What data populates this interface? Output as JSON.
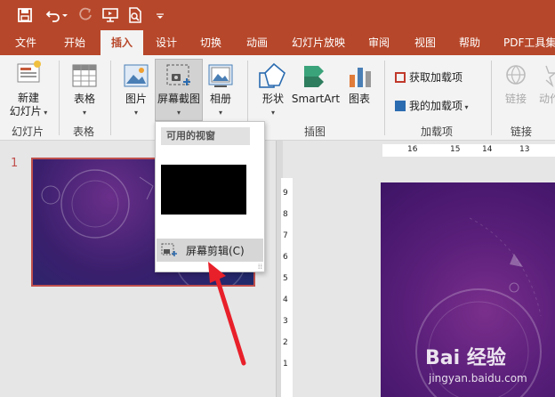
{
  "quick_access": {
    "save_icon": "save-icon",
    "undo_icon": "undo-icon",
    "redo_icon": "redo-icon",
    "present_icon": "present-from-beginning-icon",
    "print_preview_icon": "print-preview-icon",
    "customize_icon": "customize-qat-icon"
  },
  "tabs": [
    {
      "label": "文件"
    },
    {
      "label": "开始"
    },
    {
      "label": "插入"
    },
    {
      "label": "设计"
    },
    {
      "label": "切换"
    },
    {
      "label": "动画"
    },
    {
      "label": "幻灯片放映"
    },
    {
      "label": "审阅"
    },
    {
      "label": "视图"
    },
    {
      "label": "帮助"
    },
    {
      "label": "PDF工具集"
    }
  ],
  "ribbon": {
    "new_slide_label": "新建",
    "new_slide_label2": "幻灯片",
    "group_slides": "幻灯片",
    "table_label": "表格",
    "group_table": "表格",
    "picture_label": "图片",
    "screenshot_label": "屏幕截图",
    "album_label": "相册",
    "group_images": "插图",
    "shapes_label": "形状",
    "smartart_label": "SmartArt",
    "chart_label": "图表",
    "get_addins_label": "获取加载项",
    "my_addins_label": "我的加载项",
    "group_addins": "加载项",
    "link_label": "链接",
    "action_label": "动作",
    "group_links": "链接"
  },
  "slide_pane": {
    "slide_number": "1"
  },
  "rulers": {
    "h_ticks": [
      "16",
      "15",
      "14",
      "13"
    ],
    "v_ticks": [
      "9",
      "8",
      "7",
      "6",
      "5",
      "4",
      "3",
      "2",
      "1"
    ]
  },
  "dropdown": {
    "header": "可用的视窗",
    "screen_clipping_label": "屏幕剪辑(C)"
  },
  "watermark": {
    "brand": "Bai 经验",
    "url": "jingyan.baidu.com"
  },
  "colors": {
    "accent": "#b7472a",
    "ribbon_bg": "#f3f3f3",
    "slide_selected_border": "#c0504d",
    "annotation_arrow": "#e8202a"
  }
}
